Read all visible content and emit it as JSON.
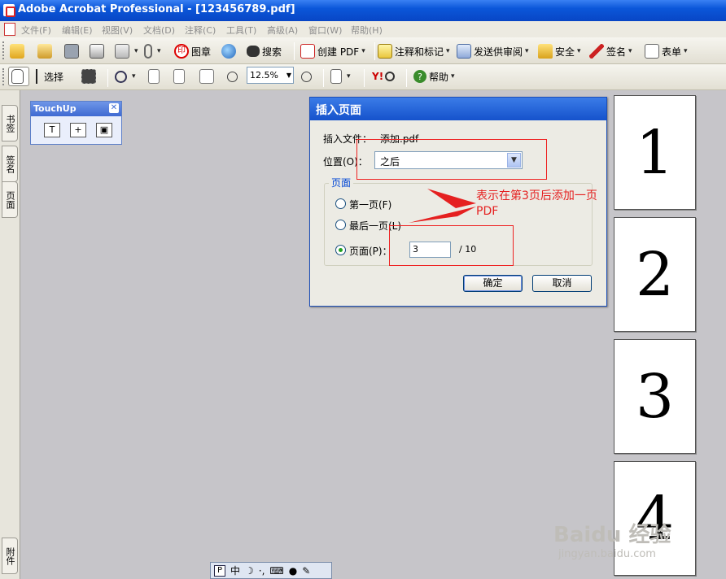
{
  "window": {
    "title": "Adobe Acrobat Professional - [123456789.pdf]"
  },
  "menu": {
    "items": [
      "文件(F)",
      "编辑(E)",
      "视图(V)",
      "文档(D)",
      "注释(C)",
      "工具(T)",
      "高级(A)",
      "窗口(W)",
      "帮助(H)"
    ]
  },
  "toolbar1": {
    "stamp_label": "图章",
    "search_label": "搜索",
    "create_pdf_label": "创建 PDF",
    "comment_label": "注释和标记",
    "review_label": "发送供审阅",
    "security_label": "安全",
    "sign_label": "签名",
    "forms_label": "表单"
  },
  "toolbar2": {
    "select_label": "选择",
    "zoom_value": "12.5%",
    "help_label": "帮助",
    "yahoo_label": "Y!"
  },
  "left_tabs": {
    "bookmarks": "书签",
    "signatures": "签名",
    "pages": "页面",
    "attachments": "附件"
  },
  "touchup": {
    "title": "TouchUp"
  },
  "dialog": {
    "title": "插入页面",
    "file_label": "插入文件：",
    "file_value": "添加.pdf",
    "position_label": "位置(O)：",
    "position_value": "之后",
    "group_label": "页面",
    "first_page_label": "第一页(F)",
    "last_page_label": "最后一页(L)",
    "page_label": "页面(P)：",
    "page_value": "3",
    "page_total": "/ 10",
    "ok_label": "确定",
    "cancel_label": "取消",
    "selected_option": "page"
  },
  "annotation": {
    "text": "表示在第3页后添加一页PDF",
    "color": "#e52020"
  },
  "thumbnails": [
    "1",
    "2",
    "3",
    "4"
  ],
  "language_bar": {
    "mode": "中"
  },
  "watermark": {
    "line1": "Baidu 经验",
    "line2": "jingyan.baidu.com"
  }
}
